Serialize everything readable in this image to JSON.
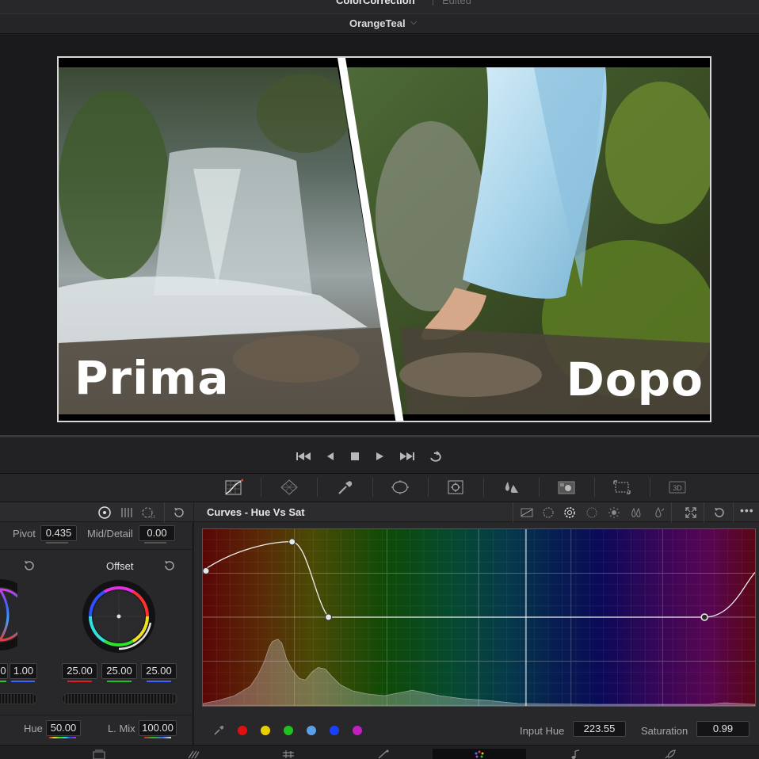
{
  "window": {
    "project_name": "ColorCorrection",
    "status": "Edited"
  },
  "clip": {
    "name": "OrangeTeal"
  },
  "viewer": {
    "before_label": "Prima",
    "after_label": "Dopo"
  },
  "transport": [
    "skip-to-start",
    "step-back",
    "stop",
    "play",
    "skip-to-end",
    "loop"
  ],
  "palette_tools": [
    "curves",
    "color-warper",
    "qualifier",
    "window",
    "tracker",
    "blur",
    "key",
    "sizing",
    "3d"
  ],
  "primaries": {
    "mode_icons": [
      "wheels-icon",
      "bars-icon",
      "log-icon",
      "reset-icon"
    ],
    "pivot_label": "Pivot",
    "pivot_value": "0.435",
    "mid_detail_label": "Mid/Detail",
    "mid_detail_value": "0.00",
    "gain_partial_value": "1.00",
    "offset": {
      "title": "Offset",
      "r": "25.00",
      "g": "25.00",
      "b": "25.00"
    },
    "hue_label": "Hue",
    "hue_value": "50.00",
    "lum_mix_label": "L. Mix",
    "lum_mix_value": "100.00"
  },
  "curves": {
    "title": "Curves - Hue Vs Sat",
    "mode_icons": [
      "custom",
      "hue-vs-hue",
      "hue-vs-sat",
      "hue-vs-lum",
      "lum-vs-sat",
      "sat-vs-sat",
      "sat-vs-lum"
    ],
    "active_mode": "hue-vs-sat",
    "swatches": [
      "#e01010",
      "#e8d000",
      "#20c020",
      "#5aa0e8",
      "#1a40ff",
      "#c020c0"
    ],
    "input_hue_label": "Input Hue",
    "input_hue_value": "223.55",
    "saturation_label": "Saturation",
    "saturation_value": "0.99",
    "control_points_norm": [
      [
        0.0,
        0.47
      ],
      [
        0.161,
        0.31
      ],
      [
        0.227,
        0.5
      ],
      [
        0.906,
        0.5
      ]
    ]
  },
  "pages": [
    "media",
    "cut",
    "edit",
    "fusion",
    "color",
    "fairlight",
    "deliver"
  ],
  "active_page": "color"
}
